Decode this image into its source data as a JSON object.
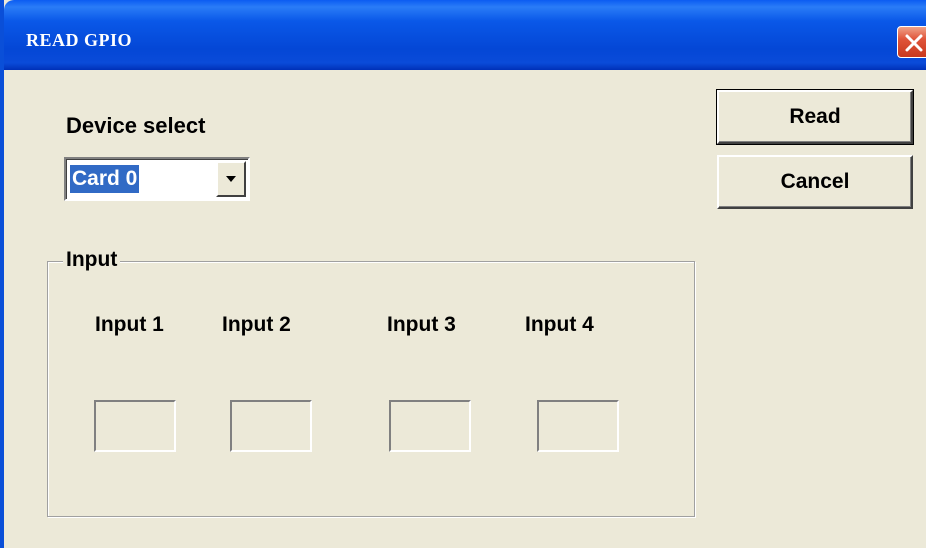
{
  "window": {
    "title": "READ GPIO"
  },
  "device_select": {
    "label": "Device select",
    "selected": "Card 0"
  },
  "buttons": {
    "read_label": "Read",
    "cancel_label": "Cancel"
  },
  "input_group": {
    "title": "Input",
    "inputs": [
      {
        "label": "Input 1",
        "value": ""
      },
      {
        "label": "Input 2",
        "value": ""
      },
      {
        "label": "Input 3",
        "value": ""
      },
      {
        "label": "Input 4",
        "value": ""
      }
    ]
  },
  "colors": {
    "titlebar": "#0a4bd9",
    "face": "#ece9d8",
    "selection": "#316ac5",
    "close": "#e0553a"
  },
  "icons": {
    "close": "close-icon",
    "dropdown": "chevron-down-icon"
  }
}
